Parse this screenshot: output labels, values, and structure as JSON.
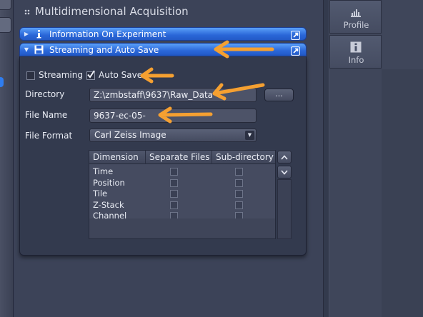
{
  "header": {
    "section_title": "Multidimensional Acquisition"
  },
  "bars": {
    "information": {
      "label": "Information On Experiment",
      "icon": "info-icon"
    },
    "streaming": {
      "label": "Streaming and Auto Save",
      "icon": "floppy-disk-icon"
    }
  },
  "options": {
    "streaming": {
      "label": "Streaming",
      "checked": false
    },
    "auto_save": {
      "label": "Auto Save",
      "checked": true
    }
  },
  "fields": {
    "directory": {
      "label": "Directory",
      "value": "Z:\\zmbstaff\\9637\\Raw_Data",
      "browse_label": "..."
    },
    "file_name": {
      "label": "File Name",
      "value": "9637-ec-05-"
    },
    "file_format": {
      "label": "File Format",
      "value": "Carl Zeiss Image"
    }
  },
  "table": {
    "columns": [
      "Dimension",
      "Separate Files",
      "Sub-directory"
    ],
    "rows": [
      {
        "dimension": "Time",
        "separate_files": false,
        "sub_directory": false
      },
      {
        "dimension": "Position",
        "separate_files": false,
        "sub_directory": false
      },
      {
        "dimension": "Tile",
        "separate_files": false,
        "sub_directory": false
      },
      {
        "dimension": "Z-Stack",
        "separate_files": false,
        "sub_directory": false
      },
      {
        "dimension": "Channel",
        "separate_files": false,
        "sub_directory": false
      }
    ]
  },
  "right_tabs": [
    {
      "label": "Profile",
      "icon": "histogram-icon"
    },
    {
      "label": "Info",
      "icon": "info-icon"
    }
  ],
  "colors": {
    "bar_blue": "#2a66d8",
    "annotation_orange": "#f5a031",
    "panel_bg": "#333a4e"
  }
}
